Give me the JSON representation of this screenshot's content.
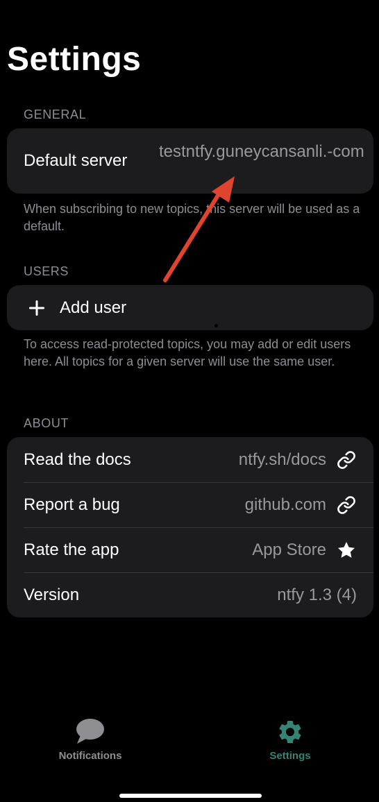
{
  "page": {
    "title": "Settings"
  },
  "general": {
    "header": "GENERAL",
    "default_server_label": "Default server",
    "default_server_value": "testntfy.guneycansanli.-com",
    "footer": "When subscribing to new topics, this server will be used as a default."
  },
  "users": {
    "header": "USERS",
    "add_user_label": "Add user",
    "footer": "To access read-protected topics, you may add or edit users here. All topics for a given server will use the same user."
  },
  "about": {
    "header": "ABOUT",
    "rows": [
      {
        "label": "Read the docs",
        "value": "ntfy.sh/docs",
        "icon": "link-icon"
      },
      {
        "label": "Report a bug",
        "value": "github.com",
        "icon": "link-icon"
      },
      {
        "label": "Rate the app",
        "value": "App Store",
        "icon": "star-icon"
      },
      {
        "label": "Version",
        "value": "ntfy 1.3 (4)"
      }
    ]
  },
  "tabs": [
    {
      "label": "Notifications",
      "icon": "chat-bubble-icon",
      "active": false
    },
    {
      "label": "Settings",
      "icon": "gear-icon",
      "active": true
    }
  ],
  "colors": {
    "background": "#000000",
    "card": "#1c1c1e",
    "secondary_text": "#8d8d93",
    "accent": "#338574",
    "tab_inactive": "#8e8e93",
    "annotation_arrow": "#e0442f"
  }
}
